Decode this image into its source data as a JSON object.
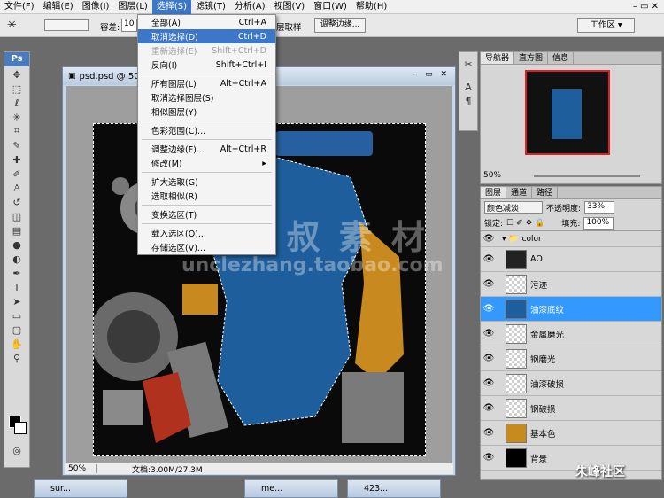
{
  "menubar": {
    "items": [
      "文件(F)",
      "编辑(E)",
      "图像(I)",
      "图层(L)",
      "选择(S)",
      "滤镜(T)",
      "分析(A)",
      "视图(V)",
      "窗口(W)",
      "帮助(H)"
    ]
  },
  "options": {
    "tolerance_label": "容差:",
    "tolerance_value": "10",
    "sample_label": "层取样",
    "refine_label": "调整边缘...",
    "workspace_label": "工作区 ▾"
  },
  "document": {
    "title": "psd.psd @ 50%",
    "zoom": "50%",
    "doc_info": "文档:3.00M/27.3M"
  },
  "select_menu": {
    "items": [
      {
        "label": "全部(A)",
        "shortcut": "Ctrl+A"
      },
      {
        "label": "取消选择(D)",
        "shortcut": "Ctrl+D"
      },
      {
        "label": "重新选择(E)",
        "shortcut": "Shift+Ctrl+D"
      },
      {
        "label": "反向(I)",
        "shortcut": "Shift+Ctrl+I"
      },
      {
        "label": "所有图层(L)",
        "shortcut": "Alt+Ctrl+A"
      },
      {
        "label": "取消选择图层(S)",
        "shortcut": ""
      },
      {
        "label": "相似图层(Y)",
        "shortcut": ""
      },
      {
        "label": "色彩范围(C)...",
        "shortcut": ""
      },
      {
        "label": "调整边缘(F)...",
        "shortcut": "Alt+Ctrl+R"
      },
      {
        "label": "修改(M)",
        "shortcut": "▸"
      },
      {
        "label": "扩大选取(G)",
        "shortcut": ""
      },
      {
        "label": "选取相似(R)",
        "shortcut": ""
      },
      {
        "label": "变换选区(T)",
        "shortcut": ""
      },
      {
        "label": "载入选区(O)...",
        "shortcut": ""
      },
      {
        "label": "存储选区(V)...",
        "shortcut": ""
      }
    ]
  },
  "navigator": {
    "tabs": [
      "导航器",
      "直方图",
      "信息"
    ],
    "zoom": "50%"
  },
  "layers": {
    "tabs": [
      "图层",
      "通道",
      "路径"
    ],
    "blend_mode": "颜色减淡",
    "opacity_label": "不透明度:",
    "opacity_value": "33%",
    "lock_label": "锁定:",
    "fill_label": "填充:",
    "fill_value": "100%",
    "group_name": "color",
    "items": [
      {
        "name": "AO"
      },
      {
        "name": "污迹"
      },
      {
        "name": "油漆底纹"
      },
      {
        "name": "金属磨光"
      },
      {
        "name": "钢磨光"
      },
      {
        "name": "油漆破损"
      },
      {
        "name": "钢破损"
      },
      {
        "name": "基本色"
      },
      {
        "name": "背景"
      }
    ]
  },
  "taskbar": {
    "items": [
      "sur...",
      "me...",
      "423..."
    ]
  },
  "watermark": {
    "main": "张 叔 叔 素 材",
    "url": "unclezhang.taobao.com",
    "corner": "朱峰社区"
  },
  "colors": {
    "accent": "#3d77c8",
    "layer_selected": "#3399ff"
  }
}
